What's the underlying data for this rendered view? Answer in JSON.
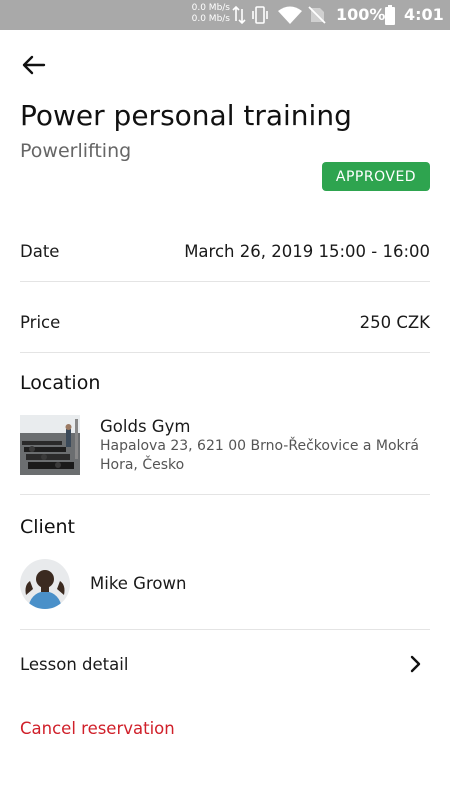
{
  "status_bar": {
    "net_up": "0.0 Mb/s",
    "net_down": "0.0 Mb/s",
    "battery": "100%",
    "time": "4:01"
  },
  "header": {
    "title": "Power personal training",
    "subtitle": "Powerlifting",
    "status": "APPROVED"
  },
  "details": {
    "date_label": "Date",
    "date_value": "March 26, 2019 15:00 - 16:00",
    "price_label": "Price",
    "price_value": "250 CZK"
  },
  "location": {
    "heading": "Location",
    "name": "Golds Gym",
    "address": "Hapalova 23, 621 00 Brno-Řečkovice a Mokrá Hora, Česko"
  },
  "client": {
    "heading": "Client",
    "name": "Mike Grown"
  },
  "actions": {
    "lesson_detail": "Lesson detail",
    "cancel": "Cancel reservation"
  },
  "colors": {
    "status_bar": "#a9a9a9",
    "approved_badge": "#2ea44f",
    "cancel_text": "#d0202a",
    "divider": "#e4e4e4"
  }
}
